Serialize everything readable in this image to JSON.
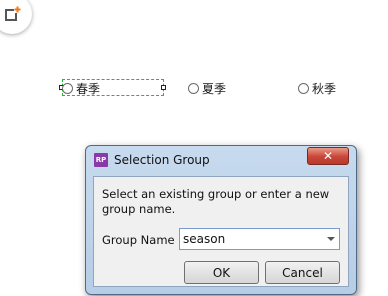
{
  "radios": [
    {
      "label": "春季"
    },
    {
      "label": "夏季"
    },
    {
      "label": "秋季"
    }
  ],
  "dialog": {
    "app_icon_text": "RP",
    "title": "Selection Group",
    "close_symbol": "✕",
    "instructions": "Select an existing group or enter a new group name.",
    "group_name_label": "Group Name",
    "group_name_value": "season",
    "ok_label": "OK",
    "cancel_label": "Cancel"
  },
  "colors": {
    "selection_outline": "#22bb33",
    "add_icon_accent": "#f07a1a",
    "app_icon_bg": "#8a3aa8"
  }
}
